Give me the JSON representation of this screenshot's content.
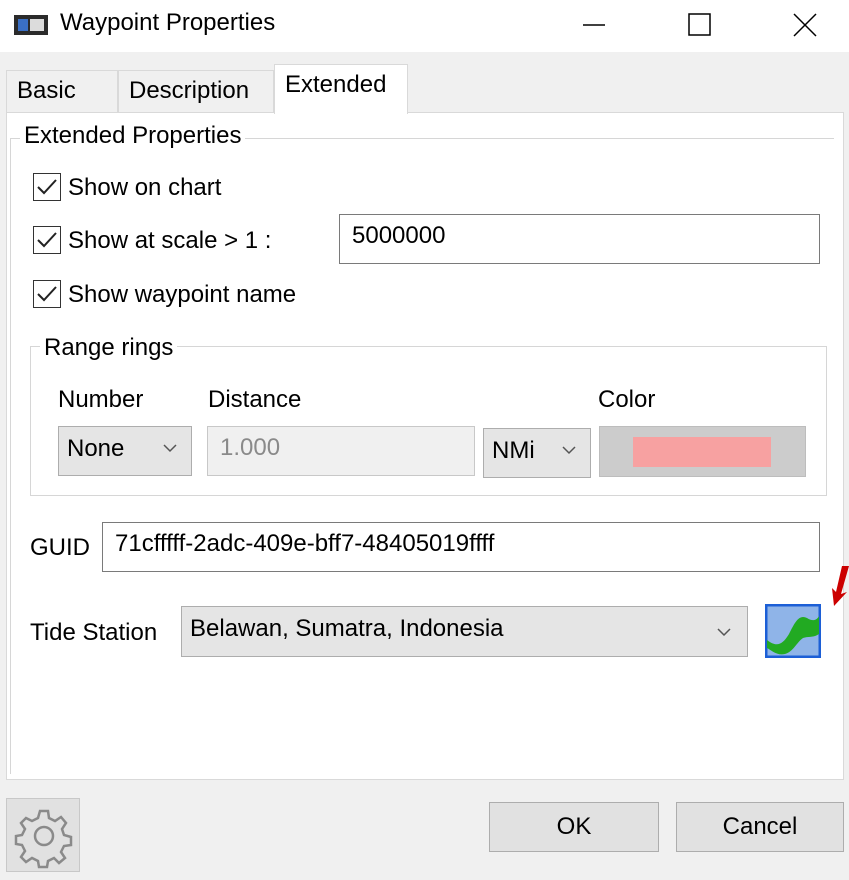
{
  "window": {
    "title": "Waypoint Properties"
  },
  "tabs": [
    {
      "label": "Basic",
      "active": false
    },
    {
      "label": "Description",
      "active": false
    },
    {
      "label": "Extended",
      "active": true
    }
  ],
  "extended": {
    "group_title": "Extended Properties",
    "show_on_chart": {
      "label": "Show on chart",
      "checked": true
    },
    "show_at_scale": {
      "label": "Show at scale > 1 :",
      "checked": true,
      "value": "5000000"
    },
    "show_waypoint_name": {
      "label": "Show waypoint name",
      "checked": true
    },
    "range_rings": {
      "title": "Range rings",
      "number_label": "Number",
      "number_value": "None",
      "distance_label": "Distance",
      "distance_value": "1.000",
      "unit_value": "NMi",
      "color_label": "Color",
      "color_swatch": "#f7a1a1"
    },
    "guid_label": "GUID",
    "guid_value": "71cfffff-2adc-409e-bff7-48405019ffff",
    "tide_station_label": "Tide Station",
    "tide_station_value": "Belawan, Sumatra, Indonesia"
  },
  "footer": {
    "ok_label": "OK",
    "cancel_label": "Cancel"
  },
  "colors": {
    "annotation_arrow": "#cc0000",
    "tide_icon_wave": "#22aa22",
    "tide_icon_border": "#1c5fd6"
  }
}
